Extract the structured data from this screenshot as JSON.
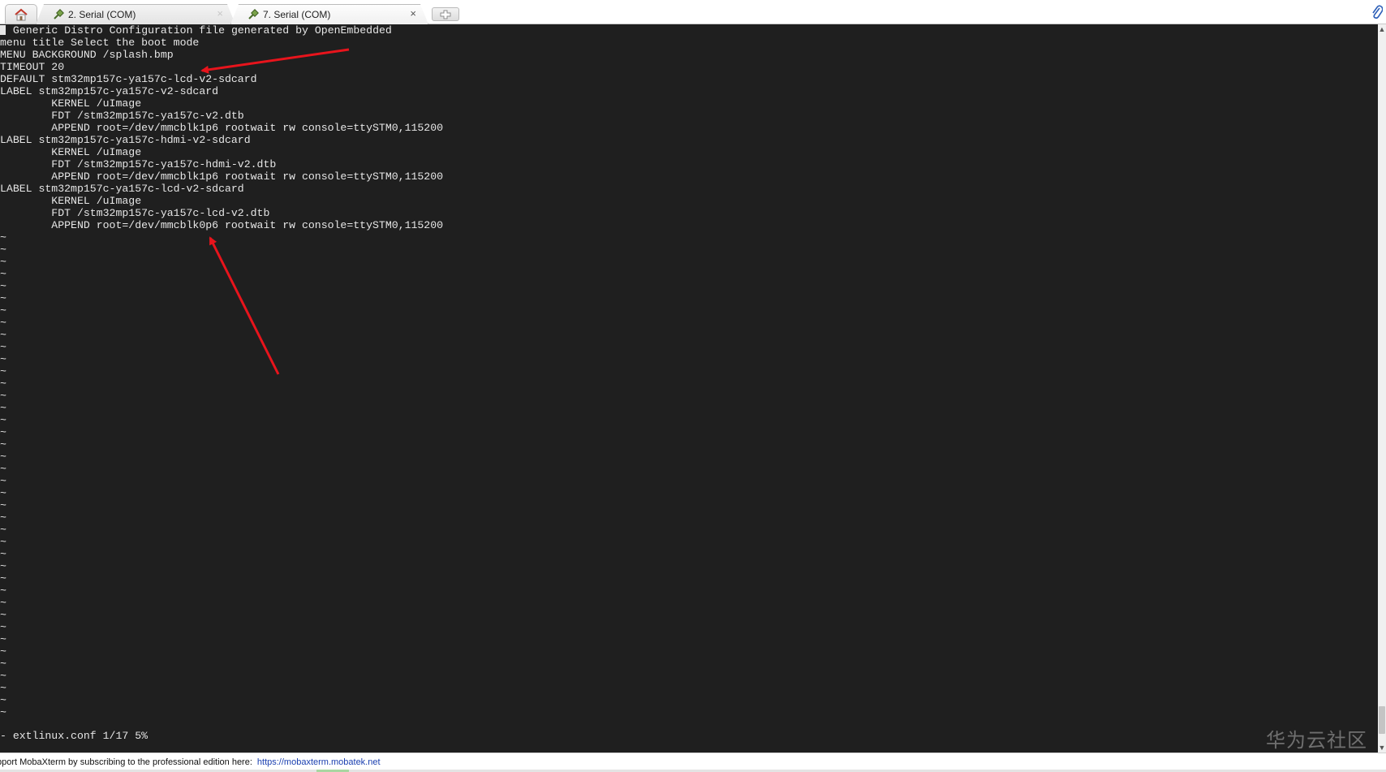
{
  "tabs": [
    {
      "label": "2. Serial (COM)",
      "icon": "serial-plug-icon",
      "active": false
    },
    {
      "label": "7. Serial (COM)",
      "icon": "serial-plug-icon",
      "active": true
    }
  ],
  "tab_close_glyph": "×",
  "terminal": {
    "lines": [
      " Generic Distro Configuration file generated by OpenEmbedded",
      "menu title Select the boot mode",
      "MENU BACKGROUND /splash.bmp",
      "TIMEOUT 20",
      "DEFAULT stm32mp157c-ya157c-lcd-v2-sdcard",
      "LABEL stm32mp157c-ya157c-v2-sdcard",
      "        KERNEL /uImage",
      "        FDT /stm32mp157c-ya157c-v2.dtb",
      "        APPEND root=/dev/mmcblk1p6 rootwait rw console=ttySTM0,115200",
      "LABEL stm32mp157c-ya157c-hdmi-v2-sdcard",
      "        KERNEL /uImage",
      "        FDT /stm32mp157c-ya157c-hdmi-v2.dtb",
      "        APPEND root=/dev/mmcblk1p6 rootwait rw console=ttySTM0,115200",
      "LABEL stm32mp157c-ya157c-lcd-v2-sdcard",
      "        KERNEL /uImage",
      "        FDT /stm32mp157c-ya157c-lcd-v2.dtb",
      "        APPEND root=/dev/mmcblk0p6 rootwait rw console=ttySTM0,115200"
    ],
    "tilde_glyph": "~",
    "tilde_count": 40,
    "status_line": "- extlinux.conf 1/17 5%",
    "background_color": "#1f1f1f",
    "text_color": "#e6e6e6",
    "annotation_color": "#e8141c"
  },
  "watermark": "华为云社区",
  "footer": {
    "message": "pport MobaXterm by subscribing to the professional edition here:",
    "link": "https://mobaxterm.mobatek.net"
  }
}
